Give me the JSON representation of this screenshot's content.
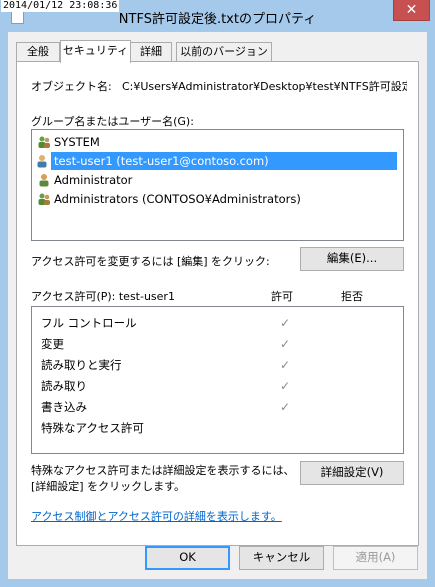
{
  "timestamp": "2014/01/12 23:08:36",
  "window": {
    "title": "NTFS許可設定後.txtのプロパティ",
    "close": "✕"
  },
  "tabs": [
    {
      "label": "全般"
    },
    {
      "label": "セキュリティ"
    },
    {
      "label": "詳細"
    },
    {
      "label": "以前のバージョン"
    }
  ],
  "security": {
    "object_label": "オブジェクト名:",
    "object_path": "C:¥Users¥Administrator¥Desktop¥test¥NTFS許可設定後.txt",
    "groups_label": "グループ名またはユーザー名(G):",
    "users": [
      {
        "name": "SYSTEM",
        "icon": "group-icon"
      },
      {
        "name": "test-user1 (test-user1@contoso.com)",
        "icon": "user-icon"
      },
      {
        "name": "Administrator",
        "icon": "user-icon"
      },
      {
        "name": "Administrators (CONTOSO¥Administrators)",
        "icon": "group-icon"
      }
    ],
    "selected_user_index": 1,
    "edit_hint": "アクセス許可を変更するには [編集] をクリック:",
    "edit_button": "編集(E)...",
    "perm_label": "アクセス許可(P): test-user1",
    "allow_header": "許可",
    "deny_header": "拒否",
    "permissions": [
      {
        "name": "フル コントロール",
        "allow": true
      },
      {
        "name": "変更",
        "allow": true
      },
      {
        "name": "読み取りと実行",
        "allow": true
      },
      {
        "name": "読み取り",
        "allow": true
      },
      {
        "name": "書き込み",
        "allow": true
      },
      {
        "name": "特殊なアクセス許可",
        "allow": false
      }
    ],
    "advanced_hint_line1": "特殊なアクセス許可または詳細設定を表示するには、",
    "advanced_hint_line2": "[詳細設定] をクリックします。",
    "advanced_button": "詳細設定(V)",
    "help_link": "アクセス制御とアクセス許可の詳細を表示します。"
  },
  "footer": {
    "ok": "OK",
    "cancel": "キャンセル",
    "apply": "適用(A)"
  },
  "colors": {
    "selection": "#3399ff",
    "link": "#0066cc",
    "close": "#c75050"
  }
}
